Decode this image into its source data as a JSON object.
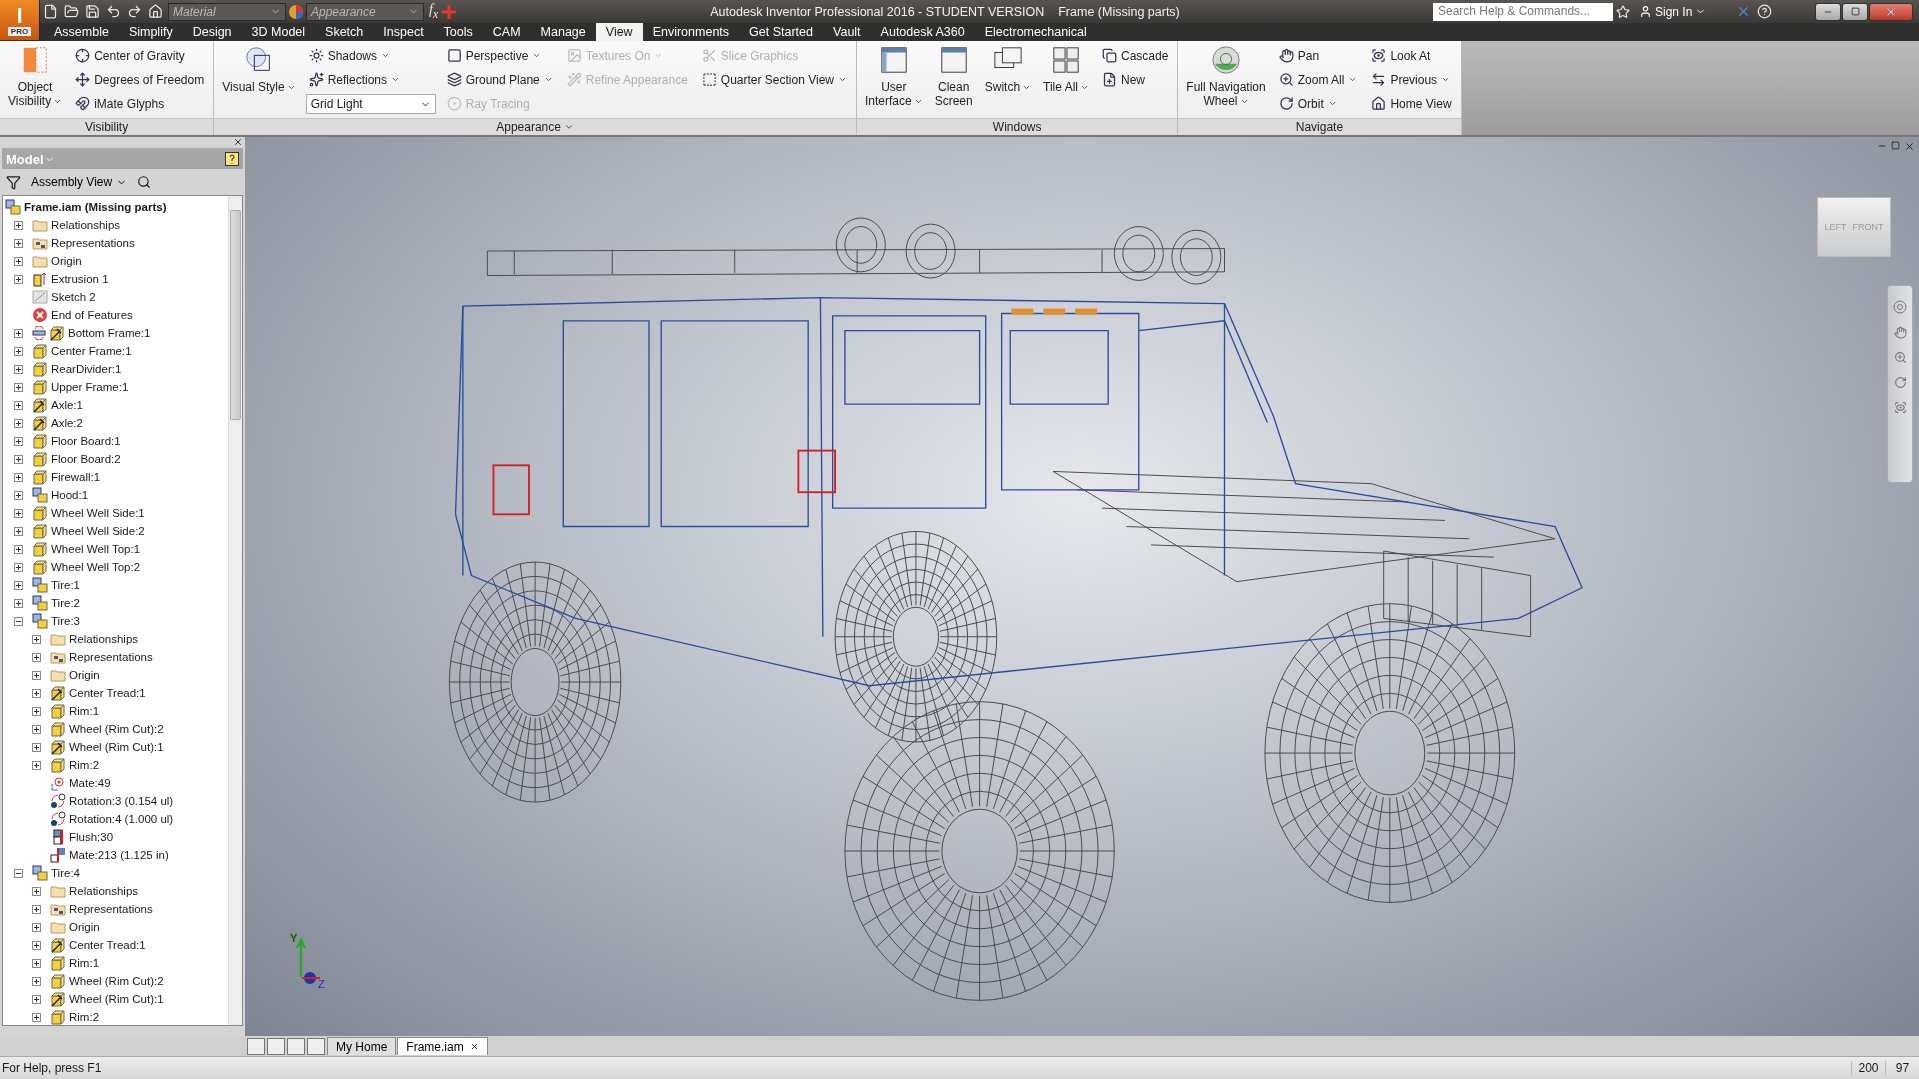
{
  "title_bar": {
    "logo": "I",
    "edition": "PRO",
    "material_combo": {
      "placeholder": "Material"
    },
    "appearance_combo": {
      "placeholder": "Appearance"
    },
    "fx_label": "f$_{x}$",
    "title": "Autodesk Inventor Professional 2016 - STUDENT VERSION",
    "document": "Frame (Missing parts)",
    "search": {
      "placeholder": "Search Help & Commands..."
    },
    "sign_in": "Sign In"
  },
  "ribbon_tabs": [
    {
      "label": "Assemble",
      "selected": false
    },
    {
      "label": "Simplify",
      "selected": false
    },
    {
      "label": "Design",
      "selected": false
    },
    {
      "label": "3D Model",
      "selected": false
    },
    {
      "label": "Sketch",
      "selected": false
    },
    {
      "label": "Inspect",
      "selected": false
    },
    {
      "label": "Tools",
      "selected": false
    },
    {
      "label": "CAM",
      "selected": false
    },
    {
      "label": "Manage",
      "selected": false
    },
    {
      "label": "View",
      "selected": true
    },
    {
      "label": "Environments",
      "selected": false
    },
    {
      "label": "Get Started",
      "selected": false
    },
    {
      "label": "Vault",
      "selected": false
    },
    {
      "label": "Autodesk A360",
      "selected": false
    },
    {
      "label": "Electromechanical",
      "selected": false
    }
  ],
  "ribbon_panels": [
    {
      "title": "Visibility",
      "menu": false,
      "columns": [
        {
          "kind": "large",
          "lines": [
            "Object",
            "Visibility"
          ],
          "dropdown": true,
          "disabled": false
        },
        {
          "kind": "small",
          "items": [
            {
              "kind": "command",
              "label": "Center of Gravity",
              "dropdown": false,
              "disabled": false
            },
            {
              "kind": "command",
              "label": "Degrees of Freedom",
              "dropdown": false,
              "disabled": false
            },
            {
              "kind": "command",
              "label": "iMate Glyphs",
              "dropdown": false,
              "disabled": false
            }
          ]
        }
      ]
    },
    {
      "title": "Appearance",
      "menu": true,
      "columns": [
        {
          "kind": "large",
          "lines": [
            "Visual Style"
          ],
          "dropdown": true,
          "disabled": false
        },
        {
          "kind": "small",
          "items": [
            {
              "kind": "command",
              "label": "Shadows",
              "dropdown": true,
              "disabled": false
            },
            {
              "kind": "command",
              "label": "Reflections",
              "dropdown": true,
              "disabled": false
            },
            {
              "kind": "combo",
              "value": "Grid Light"
            }
          ]
        },
        {
          "kind": "small",
          "items": [
            {
              "kind": "command",
              "label": "Perspective",
              "dropdown": true,
              "disabled": false
            },
            {
              "kind": "command",
              "label": "Ground Plane",
              "dropdown": true,
              "disabled": false
            },
            {
              "kind": "command",
              "label": "Ray Tracing",
              "dropdown": false,
              "disabled": true
            }
          ]
        },
        {
          "kind": "small",
          "items": [
            {
              "kind": "command",
              "label": "Textures On",
              "dropdown": true,
              "disabled": true
            },
            {
              "kind": "command",
              "label": "Refine Appearance",
              "dropdown": false,
              "disabled": true
            }
          ]
        },
        {
          "kind": "small",
          "items": [
            {
              "kind": "command",
              "label": "Slice Graphics",
              "dropdown": false,
              "disabled": true
            },
            {
              "kind": "command",
              "label": "Quarter Section View",
              "dropdown": true,
              "disabled": false
            }
          ]
        }
      ]
    },
    {
      "title": "Windows",
      "menu": false,
      "columns": [
        {
          "kind": "large",
          "lines": [
            "User",
            "Interface"
          ],
          "dropdown": true,
          "disabled": false
        },
        {
          "kind": "large",
          "lines": [
            "Clean",
            "Screen"
          ],
          "dropdown": false,
          "disabled": false
        },
        {
          "kind": "large",
          "lines": [
            "Switch"
          ],
          "dropdown": true,
          "disabled": false
        },
        {
          "kind": "large",
          "lines": [
            "Tile All"
          ],
          "dropdown": true,
          "disabled": false
        },
        {
          "kind": "small",
          "items": [
            {
              "kind": "command",
              "label": "Cascade",
              "dropdown": false,
              "disabled": false
            },
            {
              "kind": "command",
              "label": "New",
              "dropdown": false,
              "disabled": false
            }
          ]
        }
      ]
    },
    {
      "title": "Navigate",
      "menu": false,
      "columns": [
        {
          "kind": "large",
          "lines": [
            "Full Navigation",
            "Wheel"
          ],
          "dropdown": true,
          "disabled": false
        },
        {
          "kind": "small",
          "items": [
            {
              "kind": "command",
              "label": "Pan",
              "dropdown": false,
              "disabled": false
            },
            {
              "kind": "command",
              "label": "Zoom All",
              "dropdown": true,
              "disabled": false
            },
            {
              "kind": "command",
              "label": "Orbit",
              "dropdown": true,
              "disabled": false
            }
          ]
        },
        {
          "kind": "small",
          "items": [
            {
              "kind": "command",
              "label": "Look At",
              "dropdown": false,
              "disabled": false
            },
            {
              "kind": "command",
              "label": "Previous",
              "dropdown": true,
              "disabled": false
            },
            {
              "kind": "command",
              "label": "Home View",
              "dropdown": false,
              "disabled": false
            }
          ]
        }
      ]
    }
  ],
  "browser": {
    "title": "Model",
    "view_selector": "Assembly View",
    "tree": {
      "label": "Frame.iam (Missing parts)",
      "kind": "assembly",
      "children": [
        {
          "label": "Relationships",
          "kind": "folder",
          "expanded": false
        },
        {
          "label": "Representations",
          "kind": "representations",
          "expanded": false
        },
        {
          "label": "Origin",
          "kind": "folder",
          "expanded": false
        },
        {
          "label": "Extrusion 1",
          "kind": "extrusion",
          "expanded": false
        },
        {
          "label": "Sketch 2",
          "kind": "sketch"
        },
        {
          "label": "End of Features",
          "kind": "end"
        },
        {
          "label": "Bottom Frame:1",
          "kind": "adaptive",
          "expanded": false,
          "warning": true
        },
        {
          "label": "Center Frame:1",
          "kind": "part",
          "expanded": false
        },
        {
          "label": "RearDivider:1",
          "kind": "part",
          "expanded": false
        },
        {
          "label": "Upper Frame:1",
          "kind": "part",
          "expanded": false
        },
        {
          "label": "Axle:1",
          "kind": "adaptive",
          "expanded": false
        },
        {
          "label": "Axle:2",
          "kind": "adaptive",
          "expanded": false
        },
        {
          "label": "Floor Board:1",
          "kind": "part",
          "expanded": false
        },
        {
          "label": "Floor Board:2",
          "kind": "part",
          "expanded": false
        },
        {
          "label": "Firewall:1",
          "kind": "part",
          "expanded": false
        },
        {
          "label": "Hood:1",
          "kind": "assembly",
          "expanded": false
        },
        {
          "label": "Wheel Well Side:1",
          "kind": "part",
          "expanded": false
        },
        {
          "label": "Wheel Well Side:2",
          "kind": "part",
          "expanded": false
        },
        {
          "label": "Wheel Well Top:1",
          "kind": "part",
          "expanded": false
        },
        {
          "label": "Wheel Well Top:2",
          "kind": "part",
          "expanded": false
        },
        {
          "label": "Tire:1",
          "kind": "assembly",
          "expanded": false
        },
        {
          "label": "Tire:2",
          "kind": "assembly",
          "expanded": false
        },
        {
          "label": "Tire:3",
          "kind": "assembly",
          "expanded": true,
          "children": [
            {
              "label": "Relationships",
              "kind": "folder",
              "expanded": false
            },
            {
              "label": "Representations",
              "kind": "representations",
              "expanded": false
            },
            {
              "label": "Origin",
              "kind": "folder",
              "expanded": false
            },
            {
              "label": "Center Tread:1",
              "kind": "adaptive",
              "expanded": false
            },
            {
              "label": "Rim:1",
              "kind": "part",
              "expanded": false
            },
            {
              "label": "Wheel (Rim Cut):2",
              "kind": "part",
              "expanded": false
            },
            {
              "label": "Wheel (Rim Cut):1",
              "kind": "adaptive",
              "expanded": false
            },
            {
              "label": "Rim:2",
              "kind": "part",
              "expanded": false
            },
            {
              "label": "Mate:49",
              "kind": "mate"
            },
            {
              "label": "Rotation:3 (0.154 ul)",
              "kind": "rotation"
            },
            {
              "label": "Rotation:4 (1.000 ul)",
              "kind": "rotation"
            },
            {
              "label": "Flush:30",
              "kind": "flush"
            },
            {
              "label": "Mate:213 (1.125 in)",
              "kind": "mate-offset"
            }
          ]
        },
        {
          "label": "Tire:4",
          "kind": "assembly",
          "expanded": true,
          "children": [
            {
              "label": "Relationships",
              "kind": "folder",
              "expanded": false
            },
            {
              "label": "Representations",
              "kind": "representations",
              "expanded": false
            },
            {
              "label": "Origin",
              "kind": "folder",
              "expanded": false
            },
            {
              "label": "Center Tread:1",
              "kind": "adaptive",
              "expanded": false
            },
            {
              "label": "Rim:1",
              "kind": "part",
              "expanded": false
            },
            {
              "label": "Wheel (Rim Cut):2",
              "kind": "part",
              "expanded": false
            },
            {
              "label": "Wheel (Rim Cut):1",
              "kind": "adaptive",
              "expanded": false
            },
            {
              "label": "Rim:2",
              "kind": "part",
              "expanded": false
            }
          ]
        }
      ]
    }
  },
  "viewport": {
    "view_cube": [
      "LEFT",
      "FRONT"
    ],
    "triad": [
      "Y",
      "Z"
    ]
  },
  "document_tabs": [
    {
      "label": "My Home",
      "selected": false,
      "closable": false
    },
    {
      "label": "Frame.iam",
      "selected": true,
      "closable": true
    }
  ],
  "status_bar": {
    "message": "For Help, press F1",
    "counters": [
      "200",
      "97"
    ]
  }
}
